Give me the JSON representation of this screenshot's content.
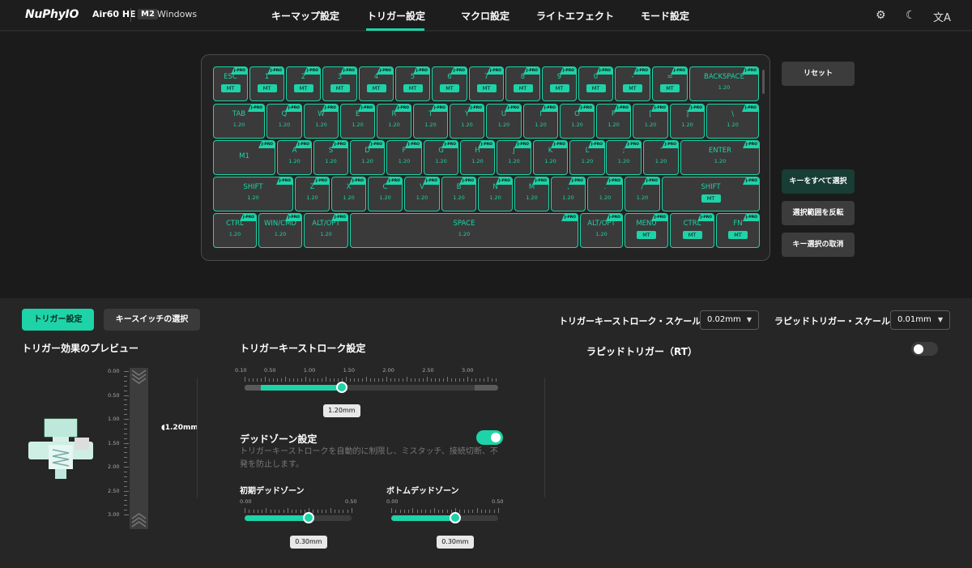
{
  "topbar": {
    "logo": "NuPhyIO",
    "model": "Air60 HE",
    "mode_badge": "M2",
    "os": "Windows",
    "nav": [
      "キーマップ設定",
      "トリガー設定",
      "マクロ設定",
      "ライトエフェクト",
      "モード設定"
    ],
    "active_nav": "トリガー設定",
    "icons": [
      "gear-icon",
      "moon-icon",
      "translate-icon"
    ]
  },
  "keyboard": {
    "accent": "#1dd3a7",
    "rows": [
      [
        {
          "label": "ESC",
          "mt": "MT"
        },
        {
          "label": "1",
          "mt": "MT"
        },
        {
          "label": "2",
          "mt": "MT"
        },
        {
          "label": "3",
          "mt": "MT"
        },
        {
          "label": "4",
          "mt": "MT"
        },
        {
          "label": "5",
          "mt": "MT"
        },
        {
          "label": "6",
          "mt": "MT"
        },
        {
          "label": "7",
          "mt": "MT"
        },
        {
          "label": "8",
          "mt": "MT"
        },
        {
          "label": "9",
          "mt": "MT"
        },
        {
          "label": "0",
          "mt": "MT"
        },
        {
          "label": "-",
          "mt": "MT"
        },
        {
          "label": "=",
          "mt": "MT"
        },
        {
          "label": "BACKSPACE",
          "val": "1.20"
        }
      ],
      [
        {
          "label": "TAB",
          "val": "1.20"
        },
        {
          "label": "Q",
          "val": "1.20"
        },
        {
          "label": "W",
          "val": "1.20"
        },
        {
          "label": "E",
          "val": "1.20"
        },
        {
          "label": "R",
          "val": "1.20"
        },
        {
          "label": "T",
          "val": "1.20"
        },
        {
          "label": "Y",
          "val": "1.20"
        },
        {
          "label": "U",
          "val": "1.20"
        },
        {
          "label": "I",
          "val": "1.20"
        },
        {
          "label": "O",
          "val": "1.20"
        },
        {
          "label": "P",
          "val": "1.20"
        },
        {
          "label": "[",
          "val": "1.20"
        },
        {
          "label": "]",
          "val": "1.20"
        },
        {
          "label": "\\",
          "val": "1.20"
        }
      ],
      [
        {
          "label": "M1",
          "val": ""
        },
        {
          "label": "A",
          "val": "1.20"
        },
        {
          "label": "S",
          "val": "1.20"
        },
        {
          "label": "D",
          "val": "1.20"
        },
        {
          "label": "F",
          "val": "1.20"
        },
        {
          "label": "G",
          "val": "1.20"
        },
        {
          "label": "H",
          "val": "1.20"
        },
        {
          "label": "J",
          "val": "1.20"
        },
        {
          "label": "K",
          "val": "1.20"
        },
        {
          "label": "L",
          "val": "1.20"
        },
        {
          "label": ";",
          "val": "1.20"
        },
        {
          "label": "'",
          "val": "1.20"
        },
        {
          "label": "ENTER",
          "val": "1.20"
        }
      ],
      [
        {
          "label": "SHIFT",
          "val": "1.20"
        },
        {
          "label": "Z",
          "val": "1.20"
        },
        {
          "label": "X",
          "val": "1.20"
        },
        {
          "label": "C",
          "val": "1.20"
        },
        {
          "label": "V",
          "val": "1.20"
        },
        {
          "label": "B",
          "val": "1.20"
        },
        {
          "label": "N",
          "val": "1.20"
        },
        {
          "label": "M",
          "val": "1.20"
        },
        {
          "label": ",",
          "val": "1.20"
        },
        {
          "label": ".",
          "val": "1.20"
        },
        {
          "label": "/",
          "val": "1.20"
        },
        {
          "label": "SHIFT",
          "mt": "MT"
        }
      ],
      [
        {
          "label": "CTRL",
          "val": "1.20"
        },
        {
          "label": "WIN/CMD",
          "val": "1.20"
        },
        {
          "label": "ALT/OPT",
          "val": "1.20"
        },
        {
          "label": "SPACE",
          "val": "1.20"
        },
        {
          "label": "ALT/OPT",
          "val": "1.20"
        },
        {
          "label": "MENU",
          "mt": "MT"
        },
        {
          "label": "CTRL",
          "mt": "MT"
        },
        {
          "label": "FN",
          "mt": "MT"
        }
      ]
    ],
    "badge": "J-PRO"
  },
  "side_buttons": {
    "reset": "リセット",
    "select_all": "キーをすべて選択",
    "invert": "選択範囲を反転",
    "deselect": "キー選択の取消"
  },
  "tabs": {
    "trigger": "トリガー設定",
    "switch": "キースイッチの選択"
  },
  "scales": {
    "stroke_label": "トリガーキーストローク・スケール",
    "stroke_value": "0.02mm",
    "rt_label": "ラピッドトリガー・スケール",
    "rt_value": "0.01mm"
  },
  "preview": {
    "title": "トリガー効果のプレビュー",
    "ticks": [
      "0.00",
      "0.50",
      "1.00",
      "1.50",
      "2.00",
      "2.50",
      "3.00"
    ],
    "current": "1.20mm",
    "current_fraction": 0.4
  },
  "stroke": {
    "title": "トリガーキーストローク設定",
    "ticks": [
      "0.10",
      "0.50",
      "1.00",
      "1.50",
      "2.00",
      "2.50",
      "3.00"
    ],
    "value": "1.20mm",
    "value_num": 1.2
  },
  "deadzone": {
    "title": "デッドゾーン設定",
    "enabled": true,
    "desc": "トリガーキーストロークを自動的に制限し、ミスタッチ、接続切断、不発を防止します。",
    "initial": {
      "title": "初期デッドゾーン",
      "min": "0.00",
      "max": "0.50",
      "value": "0.30mm",
      "value_num": 0.3
    },
    "bottom": {
      "title": "ボトムデッドゾーン",
      "min": "0.00",
      "max": "0.50",
      "value": "0.30mm",
      "value_num": 0.3
    }
  },
  "rapid": {
    "title": "ラピッドトリガー（RT）",
    "enabled": false
  }
}
